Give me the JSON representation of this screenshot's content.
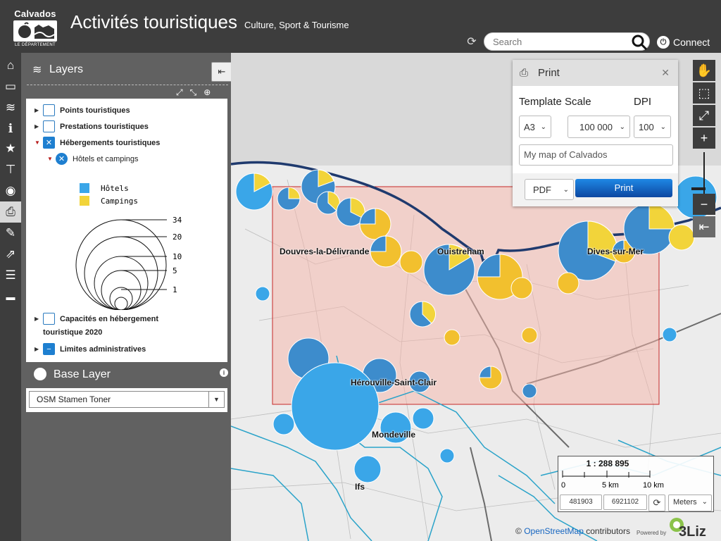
{
  "header": {
    "logo_top": "Calvados",
    "logo_bottom": "LE DÉPARTEMENT",
    "title": "Activités touristiques",
    "subtitle": "Culture, Sport & Tourisme",
    "search_placeholder": "Search",
    "connect_label": "Connect"
  },
  "leftbar": {
    "items": [
      "home-icon",
      "folder-icon",
      "layers-icon",
      "info-icon",
      "star-icon",
      "signpost-icon",
      "target-icon",
      "print-icon",
      "measure-icon",
      "share-icon",
      "list-icon",
      "comment-icon"
    ],
    "active": "print-icon"
  },
  "layers_panel": {
    "title": "Layers",
    "tree": [
      {
        "label": "Points touristiques",
        "checked": false
      },
      {
        "label": "Prestations touristiques",
        "checked": false
      },
      {
        "label": "Hébergements touristiques",
        "checked": true,
        "expanded": true
      },
      {
        "label": "Hôtels et campings",
        "checked": true,
        "expanded": true
      },
      {
        "label_line1": "Capacités en hébergement",
        "label_line2": "touristique 2020",
        "checked": false
      },
      {
        "label": "Limites administratives",
        "checked": "partial"
      }
    ],
    "legend": [
      {
        "label": "Hôtels",
        "color": "#3aa6e8"
      },
      {
        "label": "Campings",
        "color": "#f2d43a"
      }
    ],
    "size_legend": [
      "34",
      "20",
      "10",
      "5",
      "1"
    ]
  },
  "base_layer": {
    "title": "Base Layer",
    "selected": "OSM Stamen Toner"
  },
  "map": {
    "labels": [
      "Douvres-la-Délivrande",
      "Ouistreham",
      "Dives-sur-Mer",
      "Hérouville-Saint-Clair",
      "Mondeville",
      "Ifs"
    ]
  },
  "print": {
    "title": "Print",
    "template_label": "Template",
    "scale_label": "Scale",
    "dpi_label": "DPI",
    "template_value": "A3",
    "scale_value": "100 000",
    "dpi_value": "100",
    "map_title_value": "My map of Calvados",
    "format_value": "PDF",
    "print_button": "Print"
  },
  "scale": {
    "ratio": "1 : 288 895",
    "ticks": [
      "0",
      "5 km",
      "10 km"
    ],
    "coord_x": "481903",
    "coord_y": "6921102",
    "units": "Meters"
  },
  "attribution": {
    "prefix": "©",
    "link": "OpenStreetMap",
    "suffix": "contributors",
    "powered": "Powered by",
    "brand": "3Liz"
  }
}
